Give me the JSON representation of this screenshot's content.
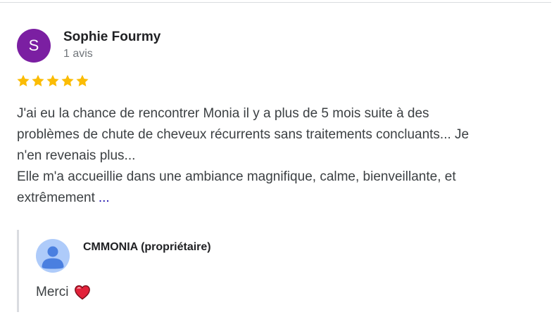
{
  "review": {
    "avatar_letter": "S",
    "avatar_color": "#7b1fa2",
    "author_name": "Sophie Fourmy",
    "review_count": "1 avis",
    "rating": 5,
    "rating_max": 5,
    "star_color": "#fbbc04",
    "text_lines": [
      "J'ai eu la chance de rencontrer Monia il y a plus de 5 mois suite à des",
      "problèmes de chute de cheveux récurrents sans traitements concluants... Je",
      "n'en revenais plus...",
      "Elle m'a accueillie dans une ambiance magnifique, calme, bienveillante, et",
      "extrêmement"
    ],
    "more_label": "..."
  },
  "owner_reply": {
    "avatar_icon": "default-user-avatar-icon",
    "owner_name": "CMMONIA (propriétaire)",
    "reply_text": "Merci",
    "emoji_icon": "red-heart-icon"
  }
}
